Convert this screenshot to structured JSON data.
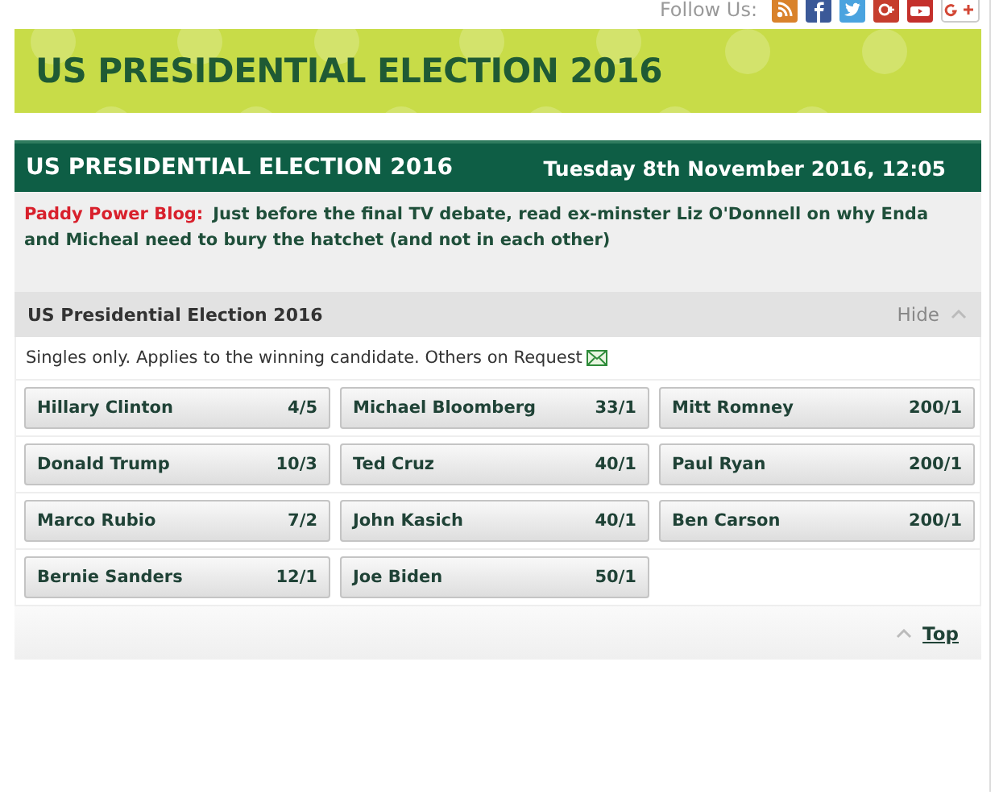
{
  "follow": {
    "label": "Follow Us:"
  },
  "banner": {
    "title": "US PRESIDENTIAL ELECTION 2016"
  },
  "panel": {
    "title": "US PRESIDENTIAL ELECTION 2016",
    "datetime": "Tuesday 8th November 2016, 12:05",
    "blog": {
      "label": "Paddy Power Blog:",
      "text": "Just before the final TV debate, read ex-minster Liz O'Donnell on why Enda and Micheal need to bury the hatchet (and not in each other)"
    }
  },
  "market": {
    "title": "US Presidential Election 2016",
    "toggle": "Hide",
    "expanded": true,
    "note": "Singles only. Applies to the winning candidate. Others on Request",
    "selections": [
      {
        "name": "Hillary Clinton",
        "odds": "4/5"
      },
      {
        "name": "Michael Bloomberg",
        "odds": "33/1"
      },
      {
        "name": "Mitt Romney",
        "odds": "200/1"
      },
      {
        "name": "Donald Trump",
        "odds": "10/3"
      },
      {
        "name": "Ted Cruz",
        "odds": "40/1"
      },
      {
        "name": "Paul Ryan",
        "odds": "200/1"
      },
      {
        "name": "Marco Rubio",
        "odds": "7/2"
      },
      {
        "name": "John Kasich",
        "odds": "40/1"
      },
      {
        "name": "Ben Carson",
        "odds": "200/1"
      },
      {
        "name": "Bernie Sanders",
        "odds": "12/1"
      },
      {
        "name": "Joe Biden",
        "odds": "50/1"
      }
    ],
    "top_link": "Top"
  }
}
